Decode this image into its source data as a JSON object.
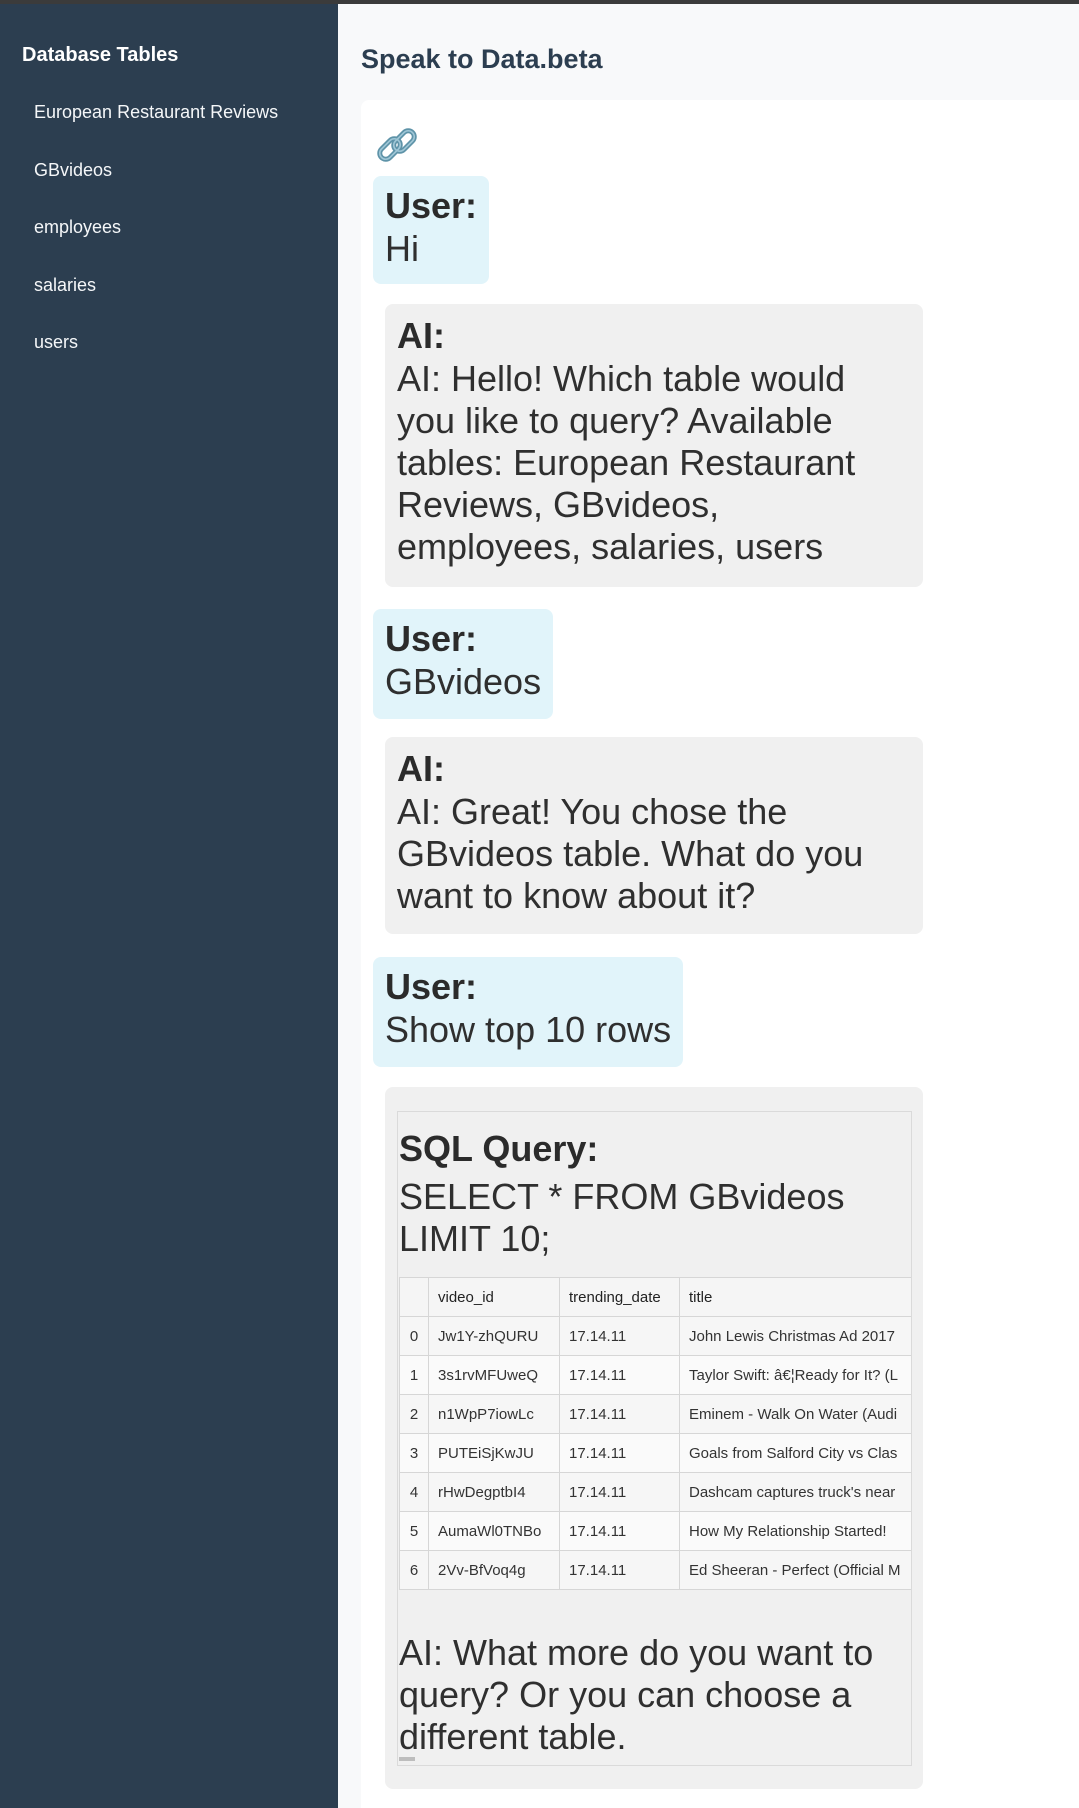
{
  "sidebar": {
    "title": "Database Tables",
    "items": [
      "European Restaurant Reviews",
      "GBvideos",
      "employees",
      "salaries",
      "users"
    ]
  },
  "header": {
    "title": "Speak to Data.beta"
  },
  "icons": {
    "share": "link-icon"
  },
  "colors": {
    "sidebar_bg": "#2c3e50",
    "user_bubble": "#e1f4fa",
    "ai_bubble": "#f0f0f0"
  },
  "chat": {
    "m1": {
      "speaker": "User:",
      "text": "Hi"
    },
    "m2": {
      "speaker": "AI:",
      "text": "AI: Hello! Which table would you like to query? Available tables: European Restaurant Reviews, GBvideos, employees, salaries, users"
    },
    "m3": {
      "speaker": "User:",
      "text": "GBvideos"
    },
    "m4": {
      "speaker": "AI:",
      "text": "AI: Great! You chose the GBvideos table. What do you want to know about it?"
    },
    "m5": {
      "speaker": "User:",
      "text": "Show top 10 rows"
    },
    "result": {
      "sql_label": "SQL Query:",
      "sql_text": "SELECT * FROM GBvideos LIMIT 10;",
      "columns": [
        "",
        "video_id",
        "trending_date",
        "title"
      ],
      "rows": [
        [
          "0",
          "Jw1Y-zhQURU",
          "17.14.11",
          "John Lewis Christmas Ad 2017"
        ],
        [
          "1",
          "3s1rvMFUweQ",
          "17.14.11",
          "Taylor Swift: â€¦Ready for It? (L"
        ],
        [
          "2",
          "n1WpP7iowLc",
          "17.14.11",
          "Eminem - Walk On Water (Audi"
        ],
        [
          "3",
          "PUTEiSjKwJU",
          "17.14.11",
          "Goals from Salford City vs Clas"
        ],
        [
          "4",
          "rHwDegptbI4",
          "17.14.11",
          "Dashcam captures truck's near"
        ],
        [
          "5",
          "AumaWl0TNBo",
          "17.14.11",
          "How My Relationship Started!"
        ],
        [
          "6",
          "2Vv-BfVoq4g",
          "17.14.11",
          "Ed Sheeran - Perfect (Official M"
        ]
      ],
      "closing": "AI: What more do you want to query? Or you can choose a different table."
    }
  }
}
